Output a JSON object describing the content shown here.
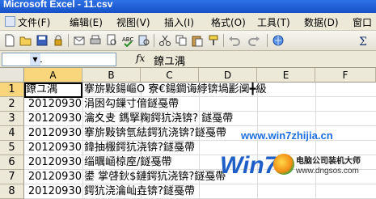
{
  "window": {
    "title": "Microsoft Excel - 11.csv"
  },
  "menu": [
    {
      "label": "文件(F)",
      "icon": "excel-icon"
    },
    {
      "label": "编辑(E)"
    },
    {
      "label": "视图(V)"
    },
    {
      "label": "插入(I)"
    },
    {
      "label": "格式(O)"
    },
    {
      "label": "工具(T)"
    },
    {
      "label": "数据(D)"
    },
    {
      "label": "窗口"
    }
  ],
  "toolbar": {
    "buttons": [
      "new-icon",
      "open-icon",
      "save-icon",
      "permission-icon",
      "mail-icon",
      "print-icon",
      "print-preview-icon",
      "spelling-icon",
      "research-icon",
      "cut-icon",
      "copy-icon",
      "paste-icon",
      "format-painter-icon",
      "undo-icon",
      "redo-icon",
      "hyperlink-icon",
      "autosum-icon"
    ]
  },
  "formula_bar": {
    "name_box": "A1",
    "fx": "fx",
    "content": "鐐ユ湡"
  },
  "columns": [
    "A",
    "B",
    "C",
    "D",
    "E",
    "F"
  ],
  "rows": [
    {
      "n": "1",
      "a": "鐐ユ湡",
      "b": "搴旂敤鍚嶇О  寮€鍚鐧诲綍锛堝彲阒╋級",
      "bb": ""
    },
    {
      "n": "2",
      "a": "20120930",
      "b": "涓囦勾鏁寸偣鐩戞帶"
    },
    {
      "n": "3",
      "a": "20120930",
      "b": "瀹夊叏  鎷掔粷鍔犺浇锛?  鐩戞帶"
    },
    {
      "n": "4",
      "a": "20120930",
      "b": "搴旂敤锛氫紶鍔犺浇锛?鐩戞帶"
    },
    {
      "n": "5",
      "a": "20120930",
      "b": "鍏抽棴鍔犺浇锛?鐩戞帶"
    },
    {
      "n": "6",
      "a": "20120930",
      "b": "缁曞崡椋庢/鐩戞帶"
    },
    {
      "n": "7",
      "a": "20120930",
      "b": "鍙  掌啔鈥$鏈鍔犺浇锛?鐩戞帶"
    },
    {
      "n": "8",
      "a": "20120930",
      "b": "鍔犺浇瀹屾垚锛?鐩戞帶"
    }
  ],
  "watermark": {
    "text": "www.win7zhijia.cn"
  },
  "logo": {
    "brand": "Win7",
    "cn": "电脑公司装机大师",
    "url": "www.dngsos.com"
  }
}
